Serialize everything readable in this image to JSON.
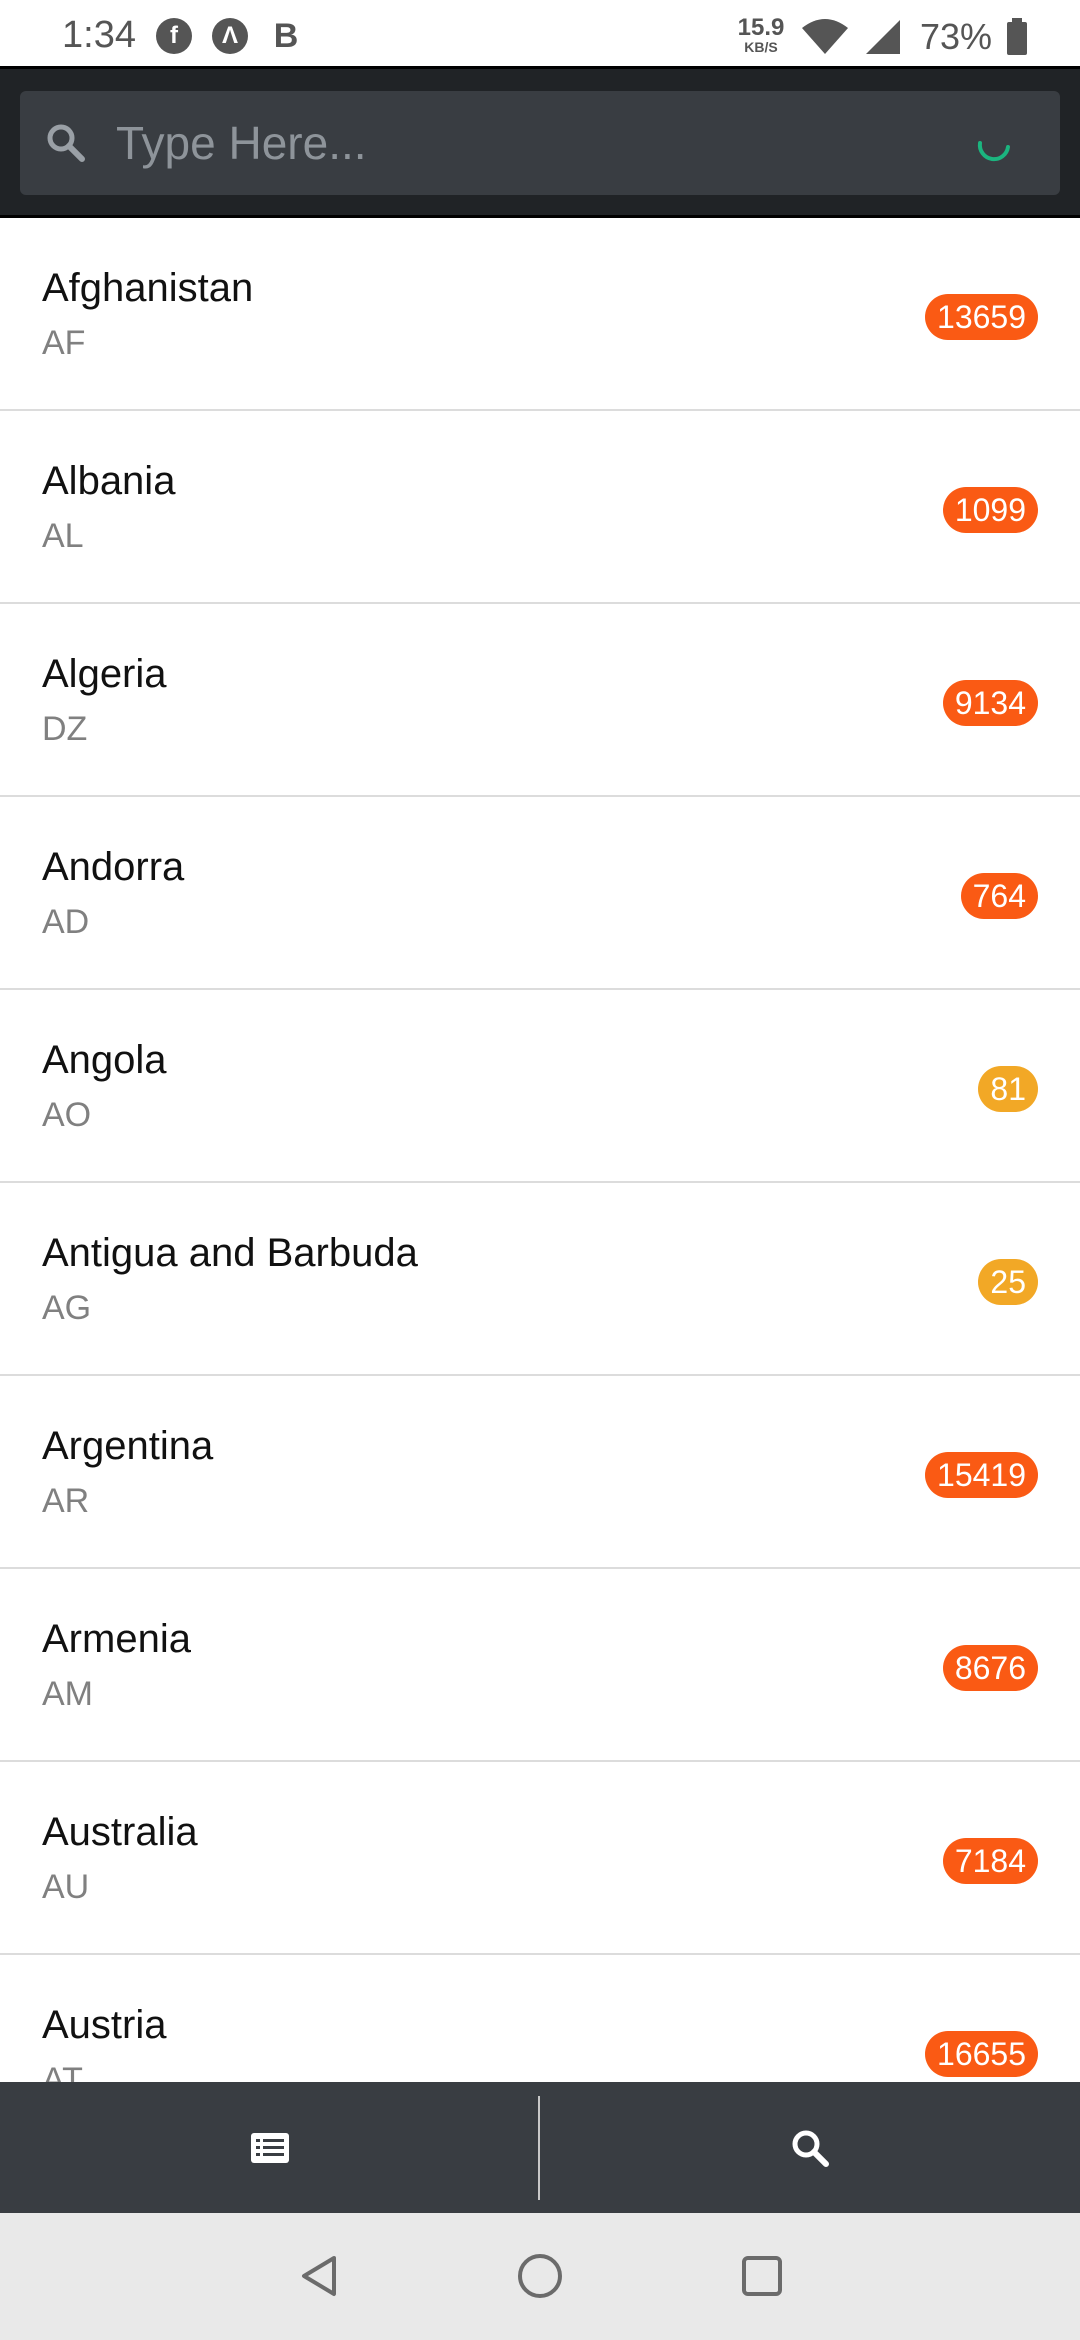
{
  "status_bar": {
    "time": "1:34",
    "left_icons": [
      "facebook-icon",
      "app-a-icon",
      "b-icon"
    ],
    "b_letter": "B",
    "a_letter": "Λ",
    "speed_value": "15.9",
    "speed_unit": "KB/S",
    "battery": "73%"
  },
  "search": {
    "placeholder": "Type Here...",
    "value": "",
    "loading": true
  },
  "colors": {
    "header_bg": "#202326",
    "search_box_bg": "#393d42",
    "badge_high": "#fa5a14",
    "badge_low": "#f2a826",
    "spinner": "#1bb57f",
    "tab_bar_bg": "#393d42"
  },
  "countries": [
    {
      "name": "Afghanistan",
      "code": "AF",
      "count": "13659",
      "level": "high"
    },
    {
      "name": "Albania",
      "code": "AL",
      "count": "1099",
      "level": "high"
    },
    {
      "name": "Algeria",
      "code": "DZ",
      "count": "9134",
      "level": "high"
    },
    {
      "name": "Andorra",
      "code": "AD",
      "count": "764",
      "level": "high"
    },
    {
      "name": "Angola",
      "code": "AO",
      "count": "81",
      "level": "low"
    },
    {
      "name": "Antigua and Barbuda",
      "code": "AG",
      "count": "25",
      "level": "low"
    },
    {
      "name": "Argentina",
      "code": "AR",
      "count": "15419",
      "level": "high"
    },
    {
      "name": "Armenia",
      "code": "AM",
      "count": "8676",
      "level": "high"
    },
    {
      "name": "Australia",
      "code": "AU",
      "count": "7184",
      "level": "high"
    },
    {
      "name": "Austria",
      "code": "AT",
      "count": "16655",
      "level": "high"
    }
  ],
  "tabs": [
    {
      "icon": "list-icon",
      "active": false
    },
    {
      "icon": "search-icon",
      "active": true
    }
  ],
  "nav": [
    "back-icon",
    "home-icon",
    "recents-icon"
  ]
}
